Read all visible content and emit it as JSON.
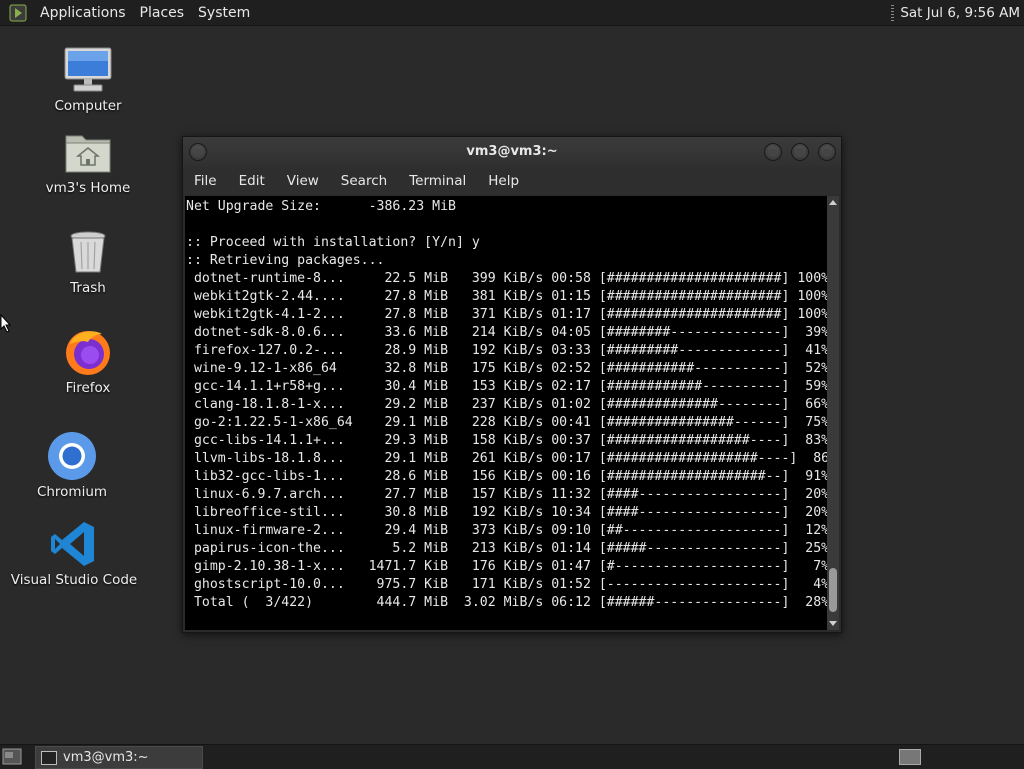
{
  "top_panel": {
    "menus": [
      "Applications",
      "Places",
      "System"
    ],
    "clock": "Sat Jul  6,  9:56 AM"
  },
  "desktop_icons": {
    "computer": "Computer",
    "home": "vm3's Home",
    "trash": "Trash",
    "firefox": "Firefox",
    "chromium": "Chromium",
    "vscode": "Visual Studio Code"
  },
  "window": {
    "title": "vm3@vm3:~",
    "menu": [
      "File",
      "Edit",
      "View",
      "Search",
      "Terminal",
      "Help"
    ],
    "terminal_lines": [
      "Net Upgrade Size:      -386.23 MiB",
      "",
      ":: Proceed with installation? [Y/n] y",
      ":: Retrieving packages...",
      " dotnet-runtime-8...     22.5 MiB   399 KiB/s 00:58 [######################] 100%",
      " webkit2gtk-2.44....     27.8 MiB   381 KiB/s 01:15 [######################] 100%",
      " webkit2gtk-4.1-2...     27.8 MiB   371 KiB/s 01:17 [######################] 100%",
      " dotnet-sdk-8.0.6...     33.6 MiB   214 KiB/s 04:05 [########--------------]  39%",
      " firefox-127.0.2-...     28.9 MiB   192 KiB/s 03:33 [#########-------------]  41%",
      " wine-9.12-1-x86_64      32.8 MiB   175 KiB/s 02:52 [###########-----------]  52%",
      " gcc-14.1.1+r58+g...     30.4 MiB   153 KiB/s 02:17 [############----------]  59%",
      " clang-18.1.8-1-x...     29.2 MiB   237 KiB/s 01:02 [##############--------]  66%",
      " go-2:1.22.5-1-x86_64    29.1 MiB   228 KiB/s 00:41 [################------]  75%",
      " gcc-libs-14.1.1+...     29.3 MiB   158 KiB/s 00:37 [##################----]  83%",
      " llvm-libs-18.1.8...     29.1 MiB   261 KiB/s 00:17 [###################----]  86%",
      " lib32-gcc-libs-1...     28.6 MiB   156 KiB/s 00:16 [####################--]  91%",
      " linux-6.9.7.arch...     27.7 MiB   157 KiB/s 11:32 [####------------------]  20%",
      " libreoffice-stil...     30.8 MiB   192 KiB/s 10:34 [####------------------]  20%",
      " linux-firmware-2...     29.4 MiB   373 KiB/s 09:10 [##--------------------]  12%",
      " papirus-icon-the...      5.2 MiB   213 KiB/s 01:14 [#####-----------------]  25%",
      " gimp-2.10.38-1-x...   1471.7 KiB   176 KiB/s 01:47 [#---------------------]   7%",
      " ghostscript-10.0...    975.7 KiB   171 KiB/s 01:52 [----------------------]   4%",
      " Total (  3/422)        444.7 MiB  3.02 MiB/s 06:12 [######----------------]  28%"
    ]
  },
  "taskbar": {
    "task_title": "vm3@vm3:~"
  }
}
